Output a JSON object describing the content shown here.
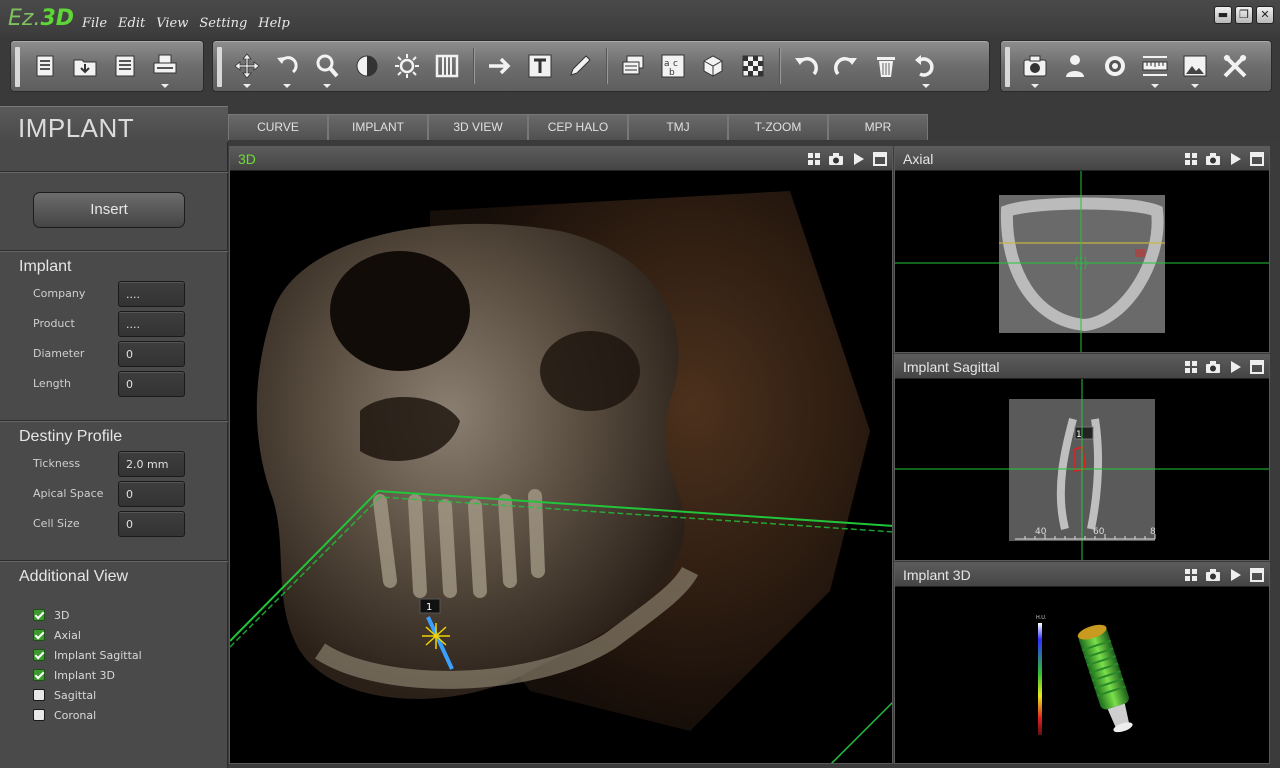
{
  "app": {
    "logo_part1": "Ez.",
    "logo_part2": "3D"
  },
  "menu": [
    "File",
    "Edit",
    "View",
    "Setting",
    "Help"
  ],
  "window_controls": {
    "minimize": "▬",
    "restore": "❐",
    "close": "✕"
  },
  "toolbar_icons": {
    "group1": [
      "new-file-icon",
      "open-folder-icon",
      "save-icon",
      "print-icon"
    ],
    "group2": [
      "move-icon",
      "rotate-icon",
      "zoom-icon",
      "contrast-icon",
      "brightness-icon",
      "window-level-icon",
      "arrow-icon",
      "text-icon",
      "pencil-icon",
      "layers-icon",
      "spellcheck-icon",
      "cube-icon",
      "checker-icon",
      "undo-icon",
      "redo-icon",
      "delete-icon",
      "reset-icon"
    ],
    "group3": [
      "camera-icon",
      "person-icon",
      "target-icon",
      "measure-icon",
      "image-icon",
      "tools-icon"
    ]
  },
  "mode_title": "IMPLANT",
  "tabs": [
    "CURVE",
    "IMPLANT",
    "3D VIEW",
    "CEP HALO",
    "TMJ",
    "T-ZOOM",
    "MPR"
  ],
  "left_panel": {
    "insert_label": "Insert",
    "implant": {
      "heading": "Implant",
      "fields": [
        {
          "label": "Company",
          "value": "...."
        },
        {
          "label": "Product",
          "value": "...."
        },
        {
          "label": "Diameter",
          "value": "0"
        },
        {
          "label": "Length",
          "value": "0"
        }
      ]
    },
    "density": {
      "heading": "Destiny Profile",
      "fields": [
        {
          "label": "Tickness",
          "value": "2.0 mm"
        },
        {
          "label": "Apical Space",
          "value": "0"
        },
        {
          "label": "Cell Size",
          "value": "0"
        }
      ]
    },
    "additional": {
      "heading": "Additional View",
      "items": [
        {
          "label": "3D",
          "checked": true
        },
        {
          "label": "Axial",
          "checked": true
        },
        {
          "label": "Implant Sagittal",
          "checked": true
        },
        {
          "label": "Implant 3D",
          "checked": true
        },
        {
          "label": "Sagittal",
          "checked": false
        },
        {
          "label": "Coronal",
          "checked": false
        }
      ]
    }
  },
  "viewports": {
    "main": {
      "title": "3D",
      "implant_marker": "1"
    },
    "axial": {
      "title": "Axial"
    },
    "sagittal": {
      "title": "Implant Sagittal",
      "implant_marker": "1",
      "ruler_labels": [
        "40",
        "60",
        "8"
      ]
    },
    "implant3d": {
      "title": "Implant 3D",
      "colorbar_label": "H.U."
    }
  },
  "colors": {
    "accent_green": "#5fd637",
    "crosshair": "#22c53a",
    "bg": "#3b3b3b"
  }
}
